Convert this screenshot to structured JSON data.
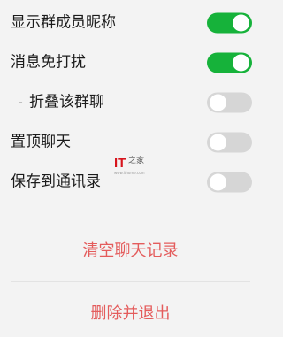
{
  "settings": {
    "show_nickname": {
      "label": "显示群成员昵称",
      "enabled": true
    },
    "mute": {
      "label": "消息免打扰",
      "enabled": true
    },
    "fold": {
      "prefix": "-",
      "label": "折叠该群聊",
      "enabled": false
    },
    "pin": {
      "label": "置顶聊天",
      "enabled": false
    },
    "save_contacts": {
      "label": "保存到通讯录",
      "enabled": false
    }
  },
  "watermark": {
    "logo": "IT",
    "name": "之家",
    "url": "www.ithome.com"
  },
  "actions": {
    "clear_history": "清空聊天记录",
    "delete_and_exit": "删除并退出"
  },
  "colors": {
    "background": "#f3f3f3",
    "toggle_on": "#16b23a",
    "toggle_off": "#d6d6d6",
    "destructive_text": "#e45c5c"
  }
}
